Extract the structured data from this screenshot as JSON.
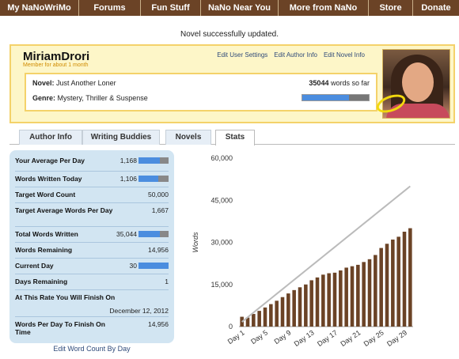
{
  "nav": {
    "items": [
      {
        "label": "My NaNoWriMo"
      },
      {
        "label": "Forums"
      },
      {
        "label": "Fun Stuff"
      },
      {
        "label": "NaNo Near You"
      },
      {
        "label": "More from NaNo"
      },
      {
        "label": "Store"
      },
      {
        "label": "Donate"
      }
    ]
  },
  "flash": "Novel successfully updated.",
  "profile": {
    "username": "MiriamDrori",
    "member_since": "Member for about 1 month",
    "links": [
      "Edit User Settings",
      "Edit Author Info",
      "Edit Novel Info"
    ],
    "novel_label": "Novel:",
    "novel_title": "Just Another Loner",
    "genre_label": "Genre:",
    "genre": "Mystery, Thriller & Suspense",
    "word_count": "35044",
    "words_suffix": "words so far",
    "progress": 0.7
  },
  "tabs": [
    "Author Info",
    "Writing Buddies",
    "Novels",
    "Stats"
  ],
  "active_tab": "Stats",
  "stats": [
    {
      "label": "Your Average Per Day",
      "value": "1,168",
      "bar": 0.7
    },
    {
      "label": "Words Written Today",
      "value": "1,106",
      "bar": 0.66
    },
    {
      "label": "Target Word Count",
      "value": "50,000"
    },
    {
      "label": "Target Average Words Per Day",
      "value": "1,667"
    },
    {
      "label": "Total Words Written",
      "value": "35,044",
      "bar": 0.7
    },
    {
      "label": "Words Remaining",
      "value": "14,956"
    },
    {
      "label": "Current Day",
      "value": "30",
      "bar": 1.0
    },
    {
      "label": "Days Remaining",
      "value": "1"
    },
    {
      "label": "At This Rate You Will Finish On",
      "value": "December 12, 2012"
    },
    {
      "label": "Words Per Day To Finish On Time",
      "value": "14,956"
    }
  ],
  "edit_word_count": "Edit Word Count By Day",
  "colors": {
    "nav": "#6b4326",
    "bar": "#6b4326",
    "target": "#bbbbbb",
    "accent": "#4b8ddf"
  },
  "chart_data": {
    "type": "bar",
    "ylabel": "Words",
    "ylim": [
      0,
      60000
    ],
    "yticks": [
      "0",
      "15,000",
      "30,000",
      "45,000",
      "60,000"
    ],
    "xticks": [
      "Day 1",
      "Day 5",
      "Day 9",
      "Day 13",
      "Day 17",
      "Day 21",
      "Day 25",
      "Day 29"
    ],
    "categories": [
      "Day 1",
      "Day 2",
      "Day 3",
      "Day 4",
      "Day 5",
      "Day 6",
      "Day 7",
      "Day 8",
      "Day 9",
      "Day 10",
      "Day 11",
      "Day 12",
      "Day 13",
      "Day 14",
      "Day 15",
      "Day 16",
      "Day 17",
      "Day 18",
      "Day 19",
      "Day 20",
      "Day 21",
      "Day 22",
      "Day 23",
      "Day 24",
      "Day 25",
      "Day 26",
      "Day 27",
      "Day 28",
      "Day 29",
      "Day 30"
    ],
    "series": [
      {
        "values": [
          3500,
          3200,
          4500,
          5600,
          6800,
          8000,
          9200,
          10500,
          11800,
          13000,
          14000,
          15000,
          16500,
          17500,
          18500,
          19000,
          19200,
          20000,
          21000,
          21500,
          22000,
          23000,
          24000,
          25500,
          28000,
          29500,
          31000,
          32000,
          33800,
          35044
        ]
      },
      {
        "values": [
          1667,
          3333,
          5000,
          6667,
          8333,
          10000,
          11667,
          13333,
          15000,
          16667,
          18333,
          20000,
          21667,
          23333,
          25000,
          26667,
          28333,
          30000,
          31667,
          33333,
          35000,
          36667,
          38333,
          40000,
          41667,
          43333,
          45000,
          46667,
          48333,
          50000
        ]
      }
    ]
  }
}
